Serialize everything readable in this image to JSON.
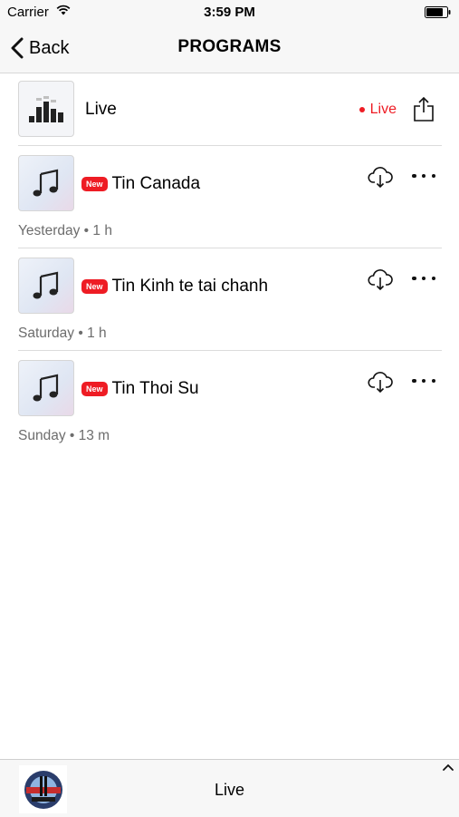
{
  "status_bar": {
    "carrier": "Carrier",
    "time": "3:59 PM",
    "icons": [
      "wifi-icon",
      "battery-icon"
    ]
  },
  "nav": {
    "back_label": "Back",
    "title": "PROGRAMS"
  },
  "live_row": {
    "title": "Live",
    "status": "Live",
    "status_color": "#ee1c24",
    "icons": [
      "equalizer-icon",
      "share-icon"
    ]
  },
  "programs": [
    {
      "badge": "New",
      "title": "Tin Canada",
      "meta": "Yesterday • 1 h"
    },
    {
      "badge": "New",
      "title": "Tin Kinh te tai chanh",
      "meta": "Saturday • 1 h"
    },
    {
      "badge": "New",
      "title": "Tin Thoi Su",
      "meta": "Sunday • 13 m"
    }
  ],
  "program_icons": [
    "music-note-icon",
    "download-cloud-icon",
    "more-icon"
  ],
  "player": {
    "title": "Live",
    "icons": [
      "station-logo-icon",
      "chevron-up-icon"
    ]
  },
  "colors": {
    "accent_red": "#ee1c24",
    "bar_background": "#f7f7f7",
    "secondary_text": "#6d6d6d"
  }
}
